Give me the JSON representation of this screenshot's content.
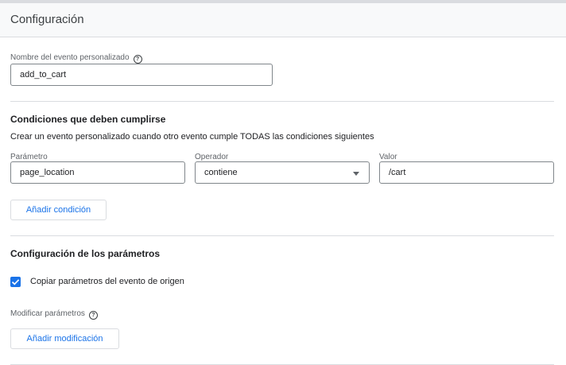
{
  "header": {
    "title": "Configuración"
  },
  "event_name": {
    "label": "Nombre del evento personalizado",
    "value": "add_to_cart"
  },
  "conditions": {
    "title": "Condiciones que deben cumplirse",
    "description": "Crear un evento personalizado cuando otro evento cumple TODAS las condiciones siguientes",
    "parameter": {
      "label": "Parámetro",
      "value": "page_location"
    },
    "operator": {
      "label": "Operador",
      "value": "contiene"
    },
    "value": {
      "label": "Valor",
      "value": "/cart"
    },
    "add_button": "Añadir condición"
  },
  "params": {
    "title": "Configuración de los parámetros",
    "copy_checkbox": {
      "label": "Copiar parámetros del evento de origen",
      "checked": true
    },
    "modify_label": "Modificar parámetros",
    "add_button": "Añadir modificación"
  },
  "colors": {
    "accent": "#1a73e8",
    "border": "#80868b",
    "divider": "#dadce0"
  },
  "icons": {
    "help": "help-circle-icon",
    "dropdown": "caret-down-icon",
    "check": "check-icon"
  }
}
